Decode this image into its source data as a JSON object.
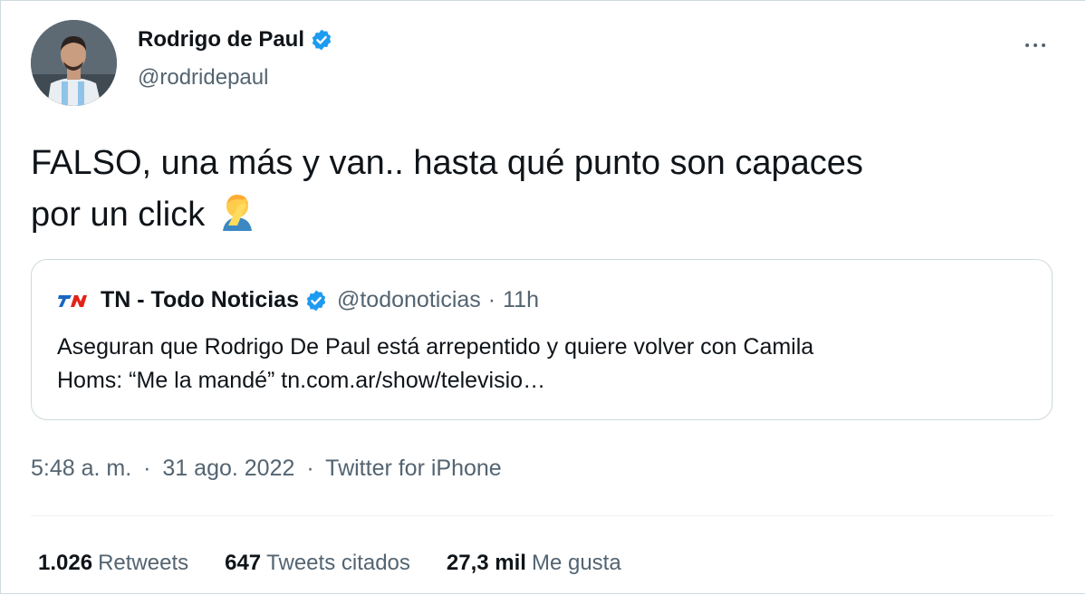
{
  "author": {
    "name": "Rodrigo de Paul",
    "handle": "@rodridepaul"
  },
  "tweet": {
    "text_line1": "FALSO, una más y van.. hasta qué punto son capaces",
    "text_line2": "por un click",
    "emoji": "facepalm-emoji"
  },
  "quoted_tweet": {
    "name": "TN - Todo Noticias",
    "handle": "@todonoticias",
    "separator": "·",
    "time": "11h",
    "text_line1": "Aseguran que Rodrigo De Paul está arrepentido y quiere volver con Camila",
    "text_line2": "Homs: “Me la mandé” tn.com.ar/show/televisio…"
  },
  "meta": {
    "time": "5:48 a. m.",
    "sep1": "·",
    "date": "31 ago. 2022",
    "sep2": "·",
    "source": "Twitter for iPhone"
  },
  "stats": {
    "retweets_count": "1.026",
    "retweets_label": "Retweets",
    "quotes_count": "647",
    "quotes_label": "Tweets citados",
    "likes_count": "27,3 mil",
    "likes_label": "Me gusta"
  },
  "colors": {
    "verified": "#1d9bf0",
    "secondary_text": "#536471",
    "primary_text": "#0f1419",
    "border": "#cfd9de"
  }
}
